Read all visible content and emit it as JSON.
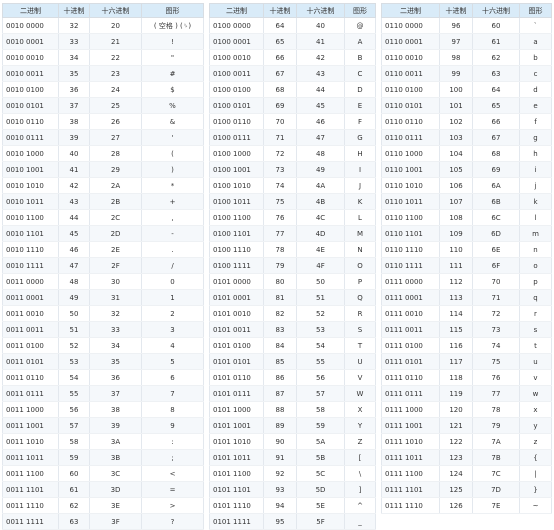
{
  "tables": [
    {
      "headers": [
        "二进制",
        "十进制",
        "十六进制",
        "图形"
      ],
      "rows": [
        [
          "0010 0000",
          "32",
          "20",
          "( 空格 ) (␠)"
        ],
        [
          "0010 0001",
          "33",
          "21",
          "!"
        ],
        [
          "0010 0010",
          "34",
          "22",
          "\""
        ],
        [
          "0010 0011",
          "35",
          "23",
          "#"
        ],
        [
          "0010 0100",
          "36",
          "24",
          "$"
        ],
        [
          "0010 0101",
          "37",
          "25",
          "%"
        ],
        [
          "0010 0110",
          "38",
          "26",
          "&"
        ],
        [
          "0010 0111",
          "39",
          "27",
          "'"
        ],
        [
          "0010 1000",
          "40",
          "28",
          "("
        ],
        [
          "0010 1001",
          "41",
          "29",
          ")"
        ],
        [
          "0010 1010",
          "42",
          "2A",
          "*"
        ],
        [
          "0010 1011",
          "43",
          "2B",
          "+"
        ],
        [
          "0010 1100",
          "44",
          "2C",
          ","
        ],
        [
          "0010 1101",
          "45",
          "2D",
          "-"
        ],
        [
          "0010 1110",
          "46",
          "2E",
          "."
        ],
        [
          "0010 1111",
          "47",
          "2F",
          "/"
        ],
        [
          "0011 0000",
          "48",
          "30",
          "0"
        ],
        [
          "0011 0001",
          "49",
          "31",
          "1"
        ],
        [
          "0011 0010",
          "50",
          "32",
          "2"
        ],
        [
          "0011 0011",
          "51",
          "33",
          "3"
        ],
        [
          "0011 0100",
          "52",
          "34",
          "4"
        ],
        [
          "0011 0101",
          "53",
          "35",
          "5"
        ],
        [
          "0011 0110",
          "54",
          "36",
          "6"
        ],
        [
          "0011 0111",
          "55",
          "37",
          "7"
        ],
        [
          "0011 1000",
          "56",
          "38",
          "8"
        ],
        [
          "0011 1001",
          "57",
          "39",
          "9"
        ],
        [
          "0011 1010",
          "58",
          "3A",
          ":"
        ],
        [
          "0011 1011",
          "59",
          "3B",
          ";"
        ],
        [
          "0011 1100",
          "60",
          "3C",
          "<"
        ],
        [
          "0011 1101",
          "61",
          "3D",
          "="
        ],
        [
          "0011 1110",
          "62",
          "3E",
          ">"
        ],
        [
          "0011 1111",
          "63",
          "3F",
          "?"
        ]
      ]
    },
    {
      "headers": [
        "二进制",
        "十进制",
        "十六进制",
        "图形"
      ],
      "rows": [
        [
          "0100 0000",
          "64",
          "40",
          "@"
        ],
        [
          "0100 0001",
          "65",
          "41",
          "A"
        ],
        [
          "0100 0010",
          "66",
          "42",
          "B"
        ],
        [
          "0100 0011",
          "67",
          "43",
          "C"
        ],
        [
          "0100 0100",
          "68",
          "44",
          "D"
        ],
        [
          "0100 0101",
          "69",
          "45",
          "E"
        ],
        [
          "0100 0110",
          "70",
          "46",
          "F"
        ],
        [
          "0100 0111",
          "71",
          "47",
          "G"
        ],
        [
          "0100 1000",
          "72",
          "48",
          "H"
        ],
        [
          "0100 1001",
          "73",
          "49",
          "I"
        ],
        [
          "0100 1010",
          "74",
          "4A",
          "J"
        ],
        [
          "0100 1011",
          "75",
          "4B",
          "K"
        ],
        [
          "0100 1100",
          "76",
          "4C",
          "L"
        ],
        [
          "0100 1101",
          "77",
          "4D",
          "M"
        ],
        [
          "0100 1110",
          "78",
          "4E",
          "N"
        ],
        [
          "0100 1111",
          "79",
          "4F",
          "O"
        ],
        [
          "0101 0000",
          "80",
          "50",
          "P"
        ],
        [
          "0101 0001",
          "81",
          "51",
          "Q"
        ],
        [
          "0101 0010",
          "82",
          "52",
          "R"
        ],
        [
          "0101 0011",
          "83",
          "53",
          "S"
        ],
        [
          "0101 0100",
          "84",
          "54",
          "T"
        ],
        [
          "0101 0101",
          "85",
          "55",
          "U"
        ],
        [
          "0101 0110",
          "86",
          "56",
          "V"
        ],
        [
          "0101 0111",
          "87",
          "57",
          "W"
        ],
        [
          "0101 1000",
          "88",
          "58",
          "X"
        ],
        [
          "0101 1001",
          "89",
          "59",
          "Y"
        ],
        [
          "0101 1010",
          "90",
          "5A",
          "Z"
        ],
        [
          "0101 1011",
          "91",
          "5B",
          "["
        ],
        [
          "0101 1100",
          "92",
          "5C",
          "\\"
        ],
        [
          "0101 1101",
          "93",
          "5D",
          "]"
        ],
        [
          "0101 1110",
          "94",
          "5E",
          "^"
        ],
        [
          "0101 1111",
          "95",
          "5F",
          "_"
        ]
      ]
    },
    {
      "headers": [
        "二进制",
        "十进制",
        "十六进制",
        "图形"
      ],
      "rows": [
        [
          "0110 0000",
          "96",
          "60",
          "`"
        ],
        [
          "0110 0001",
          "97",
          "61",
          "a"
        ],
        [
          "0110 0010",
          "98",
          "62",
          "b"
        ],
        [
          "0110 0011",
          "99",
          "63",
          "c"
        ],
        [
          "0110 0100",
          "100",
          "64",
          "d"
        ],
        [
          "0110 0101",
          "101",
          "65",
          "e"
        ],
        [
          "0110 0110",
          "102",
          "66",
          "f"
        ],
        [
          "0110 0111",
          "103",
          "67",
          "g"
        ],
        [
          "0110 1000",
          "104",
          "68",
          "h"
        ],
        [
          "0110 1001",
          "105",
          "69",
          "i"
        ],
        [
          "0110 1010",
          "106",
          "6A",
          "j"
        ],
        [
          "0110 1011",
          "107",
          "6B",
          "k"
        ],
        [
          "0110 1100",
          "108",
          "6C",
          "l"
        ],
        [
          "0110 1101",
          "109",
          "6D",
          "m"
        ],
        [
          "0110 1110",
          "110",
          "6E",
          "n"
        ],
        [
          "0110 1111",
          "111",
          "6F",
          "o"
        ],
        [
          "0111 0000",
          "112",
          "70",
          "p"
        ],
        [
          "0111 0001",
          "113",
          "71",
          "q"
        ],
        [
          "0111 0010",
          "114",
          "72",
          "r"
        ],
        [
          "0111 0011",
          "115",
          "73",
          "s"
        ],
        [
          "0111 0100",
          "116",
          "74",
          "t"
        ],
        [
          "0111 0101",
          "117",
          "75",
          "u"
        ],
        [
          "0111 0110",
          "118",
          "76",
          "v"
        ],
        [
          "0111 0111",
          "119",
          "77",
          "w"
        ],
        [
          "0111 1000",
          "120",
          "78",
          "x"
        ],
        [
          "0111 1001",
          "121",
          "79",
          "y"
        ],
        [
          "0111 1010",
          "122",
          "7A",
          "z"
        ],
        [
          "0111 1011",
          "123",
          "7B",
          "{"
        ],
        [
          "0111 1100",
          "124",
          "7C",
          "|"
        ],
        [
          "0111 1101",
          "125",
          "7D",
          "}"
        ],
        [
          "0111 1110",
          "126",
          "7E",
          "~"
        ]
      ]
    }
  ]
}
